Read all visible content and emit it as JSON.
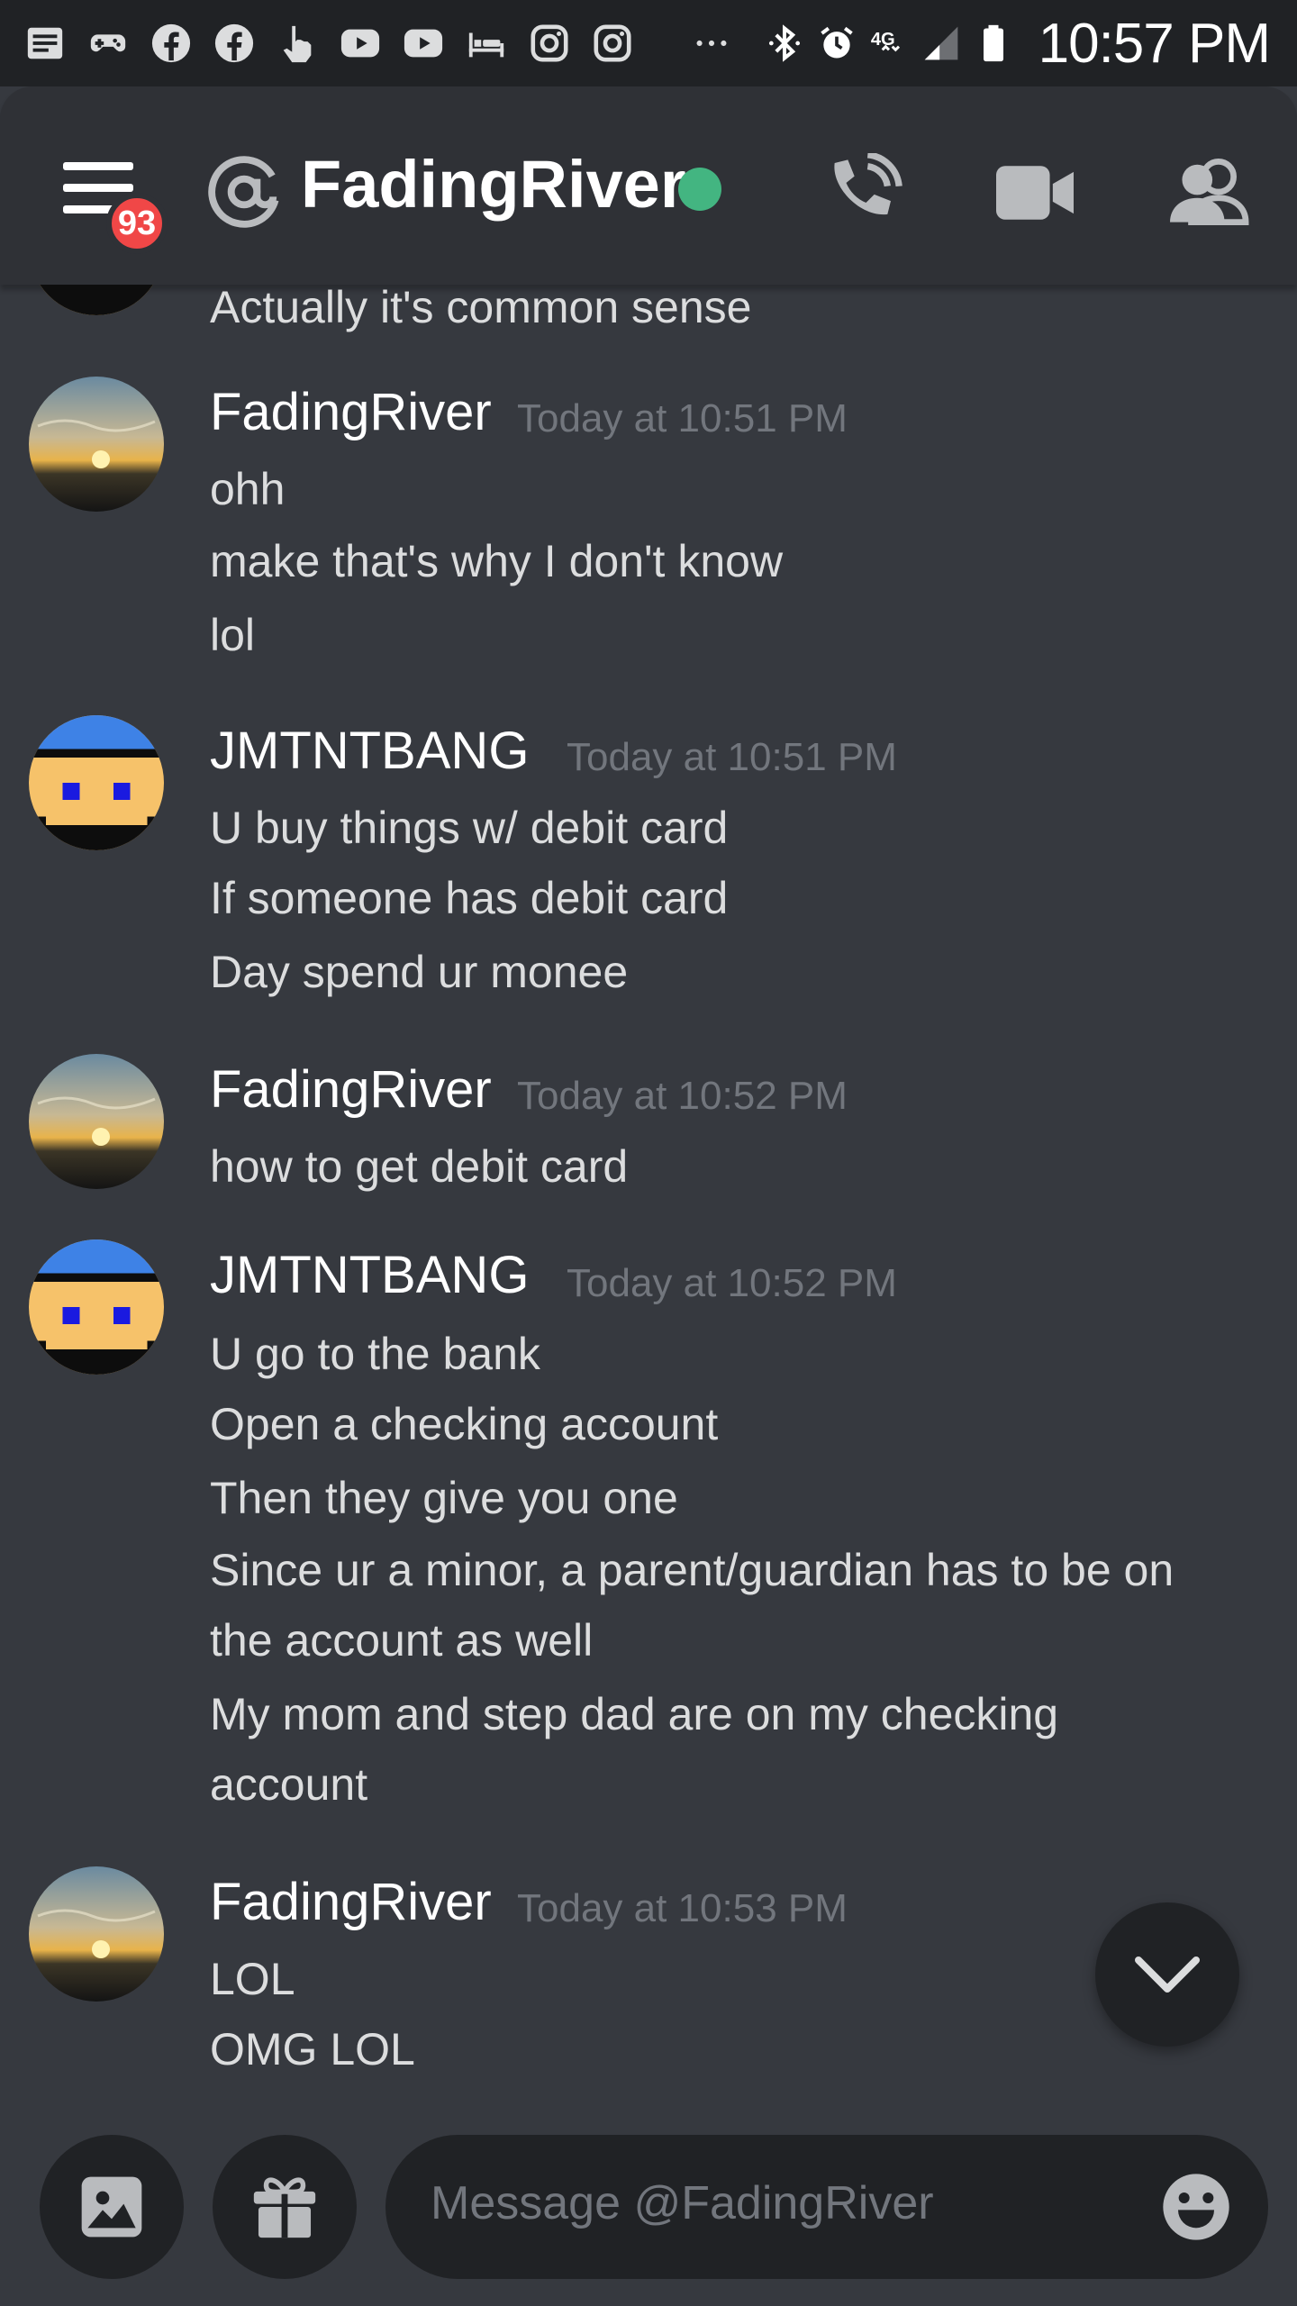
{
  "statusbar": {
    "time": "10:57 PM",
    "left_icons": [
      "news-icon",
      "gamepad-icon",
      "facebook-icon",
      "facebook-icon",
      "touch-icon",
      "youtube-icon",
      "youtube-icon",
      "bed-icon",
      "instagram-icon",
      "instagram-icon",
      "more-dots-icon"
    ],
    "network_label": "4G",
    "right_icons": [
      "bluetooth-icon",
      "alarm-icon",
      "network-4g-icon",
      "signal-icon",
      "battery-icon"
    ]
  },
  "header": {
    "badge_count": "93",
    "at_symbol": "@",
    "title": "FadingRiver",
    "status_color": "#43b581",
    "buttons": [
      "call-icon",
      "video-icon",
      "members-icon"
    ]
  },
  "messages": [
    {
      "continued": true,
      "lines": [
        "Actually it's common sense"
      ]
    },
    {
      "author": "FadingRiver",
      "time": "Today at 10:51 PM",
      "avatar": "sunset-avatar",
      "lines": [
        "ohh",
        "make that's why I don't know",
        "lol"
      ]
    },
    {
      "author": "JMTNTBANG",
      "time": "Today at 10:51 PM",
      "avatar": "pixel-face-avatar",
      "lines": [
        "U buy things w/ debit card",
        "If someone has debit card",
        "Day spend ur monee"
      ]
    },
    {
      "author": "FadingRiver",
      "time": "Today at 10:52 PM",
      "avatar": "sunset-avatar",
      "lines": [
        "how to get debit card"
      ]
    },
    {
      "author": "JMTNTBANG",
      "time": "Today at 10:52 PM",
      "avatar": "pixel-face-avatar",
      "lines": [
        "U go to the bank",
        "Open a checking account",
        "Then they give you one",
        "Since ur a minor, a parent/guardian has to be on",
        "the account as well",
        "My mom and step dad are on my checking",
        "account"
      ]
    },
    {
      "author": "FadingRiver",
      "time": "Today at 10:53 PM",
      "avatar": "sunset-avatar",
      "lines": [
        "LOL",
        "OMG LOL"
      ]
    }
  ],
  "composer": {
    "placeholder": "Message @FadingRiver",
    "buttons": [
      "image-icon",
      "gift-icon",
      "emoji-icon"
    ]
  },
  "colors": {
    "background": "#36393f",
    "header": "#2f3136",
    "input": "#202225",
    "timestamp": "#72767d",
    "badge": "#f04747"
  }
}
